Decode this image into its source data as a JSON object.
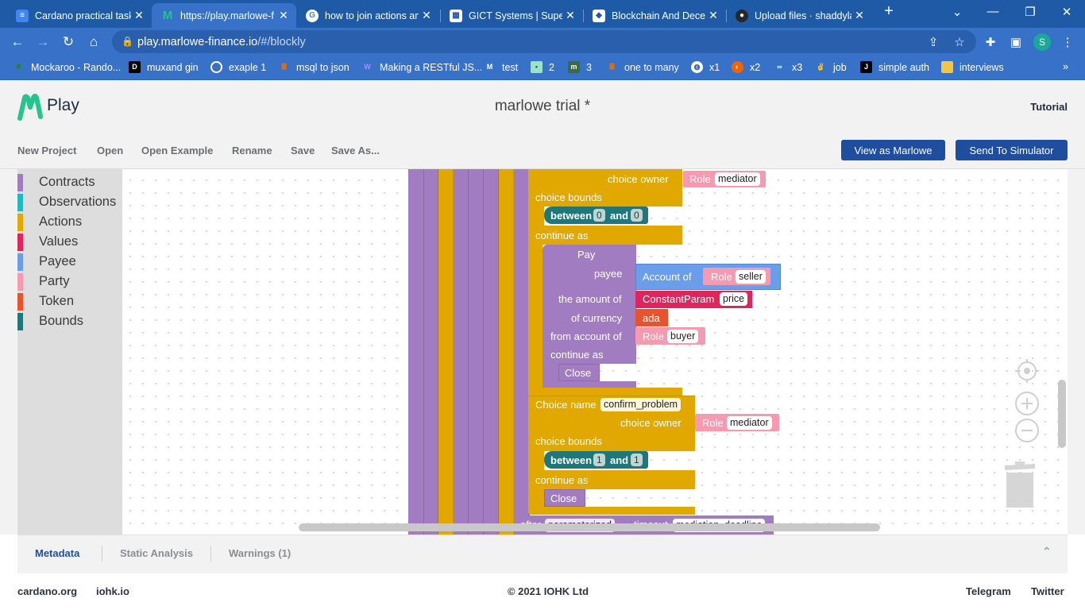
{
  "browser": {
    "tabs": [
      {
        "title": "Cardano practical task",
        "icon": "docs-icon",
        "color": "#4285f4"
      },
      {
        "title": "https://play.marlowe-f",
        "icon": "marlowe-icon",
        "color": "#23c48e"
      },
      {
        "title": "how to join actions an",
        "icon": "google-icon",
        "color": "#ffffff"
      },
      {
        "title": "GICT Systems | Super",
        "icon": "gict-icon",
        "color": "#ffffff"
      },
      {
        "title": "Blockchain And Decen",
        "icon": "blockchain-icon",
        "color": "#ffffff"
      },
      {
        "title": "Upload files · shaddyla",
        "icon": "github-icon",
        "color": "#24292e"
      }
    ],
    "url_host": "play.marlowe-finance.io",
    "url_path": "/#/blockly",
    "profile_initial": "S",
    "bookmarks": [
      {
        "label": "Mockaroo - Rando...",
        "icon": "mockaroo-icon",
        "color": "#2e7d32"
      },
      {
        "label": "muxand gin",
        "icon": "dev-icon",
        "color": "#000000"
      },
      {
        "label": "exaple 1",
        "icon": "target-icon",
        "color": "#ffffff"
      },
      {
        "label": "msql to json",
        "icon": "stackoverflow-icon",
        "color": "#e07a1f"
      },
      {
        "label": "Making a RESTful JS...",
        "icon": "w-icon",
        "color": "#7b3fe4"
      },
      {
        "label": "test",
        "icon": "gmail-icon",
        "color": "#1565c0"
      },
      {
        "label": "2",
        "icon": "square-icon",
        "color": "#9be2c8"
      },
      {
        "label": "3",
        "icon": "mh-icon",
        "color": "#3d6b3d"
      },
      {
        "label": "one to many",
        "icon": "stackoverflow-icon",
        "color": "#e07a1f"
      },
      {
        "label": "x1",
        "icon": "globe-icon",
        "color": "#ffffff"
      },
      {
        "label": "x2",
        "icon": "replit-icon",
        "color": "#f26207"
      },
      {
        "label": "x3",
        "icon": "infinity-icon",
        "color": "#ffffff"
      },
      {
        "label": "job",
        "icon": "hand-icon",
        "color": "#f4c542"
      },
      {
        "label": "simple auth",
        "icon": "j-icon",
        "color": "#000000"
      },
      {
        "label": "interviews",
        "icon": "folder-icon",
        "color": "#f6c545"
      }
    ]
  },
  "app": {
    "logo_text": "Play",
    "project_title": "marlowe trial *",
    "tutorial": "Tutorial",
    "menu": [
      "New Project",
      "Open",
      "Open Example",
      "Rename",
      "Save",
      "Save As..."
    ],
    "view_as_marlowe": "View as Marlowe",
    "send_to_simulator": "Send To Simulator"
  },
  "toolbox": [
    {
      "label": "Contracts",
      "color": "#a27cc0"
    },
    {
      "label": "Observations",
      "color": "#22b8c2"
    },
    {
      "label": "Actions",
      "color": "#e0a800"
    },
    {
      "label": "Values",
      "color": "#e0245e"
    },
    {
      "label": "Payee",
      "color": "#6a9eea"
    },
    {
      "label": "Party",
      "color": "#f59ab0"
    },
    {
      "label": "Token",
      "color": "#e8532c"
    },
    {
      "label": "Bounds",
      "color": "#1f777c"
    }
  ],
  "blocks": {
    "choice_owner_1": "choice owner",
    "role_1": "Role",
    "role_1_value": "mediator",
    "choice_bounds_1": "choice bounds",
    "between_1": "between",
    "between_1_low": "0",
    "and_1": "and",
    "between_1_high": "0",
    "continue_as_1": "continue as",
    "pay": "Pay",
    "payee": "payee",
    "account_of": "Account of",
    "role_seller": "Role",
    "role_seller_value": "seller",
    "amount_of": "the amount of",
    "constant_param": "ConstantParam",
    "constant_param_value": "price",
    "of_currency": "of currency",
    "ada": "ada",
    "from_account_of": "from account of",
    "role_buyer": "Role",
    "role_buyer_value": "buyer",
    "pay_continue_as": "continue as",
    "close_1": "Close",
    "choice_name": "Choice name",
    "choice_name_value": "confirm_problem",
    "choice_owner_2": "choice owner",
    "role_2": "Role",
    "role_2_value": "mediator",
    "choice_bounds_2": "choice bounds",
    "between_2": "between",
    "between_2_low": "1",
    "and_2": "and",
    "between_2_high": "1",
    "continue_as_2": "continue as",
    "close_2": "Close",
    "after": "after",
    "after_param": "parameterized",
    "timeout": "timeout",
    "timeout_value": "mediation_deadline"
  },
  "bottom_tabs": [
    "Metadata",
    "Static Analysis",
    "Warnings (1)"
  ],
  "footer": {
    "left": [
      "cardano.org",
      "iohk.io"
    ],
    "center": "© 2021 IOHK Ltd",
    "right": [
      "Telegram",
      "Twitter"
    ]
  },
  "colors": {
    "contract": "#a27cc0",
    "action": "#e0a800",
    "bounds": "#1f777c",
    "payee": "#6a9eea",
    "party": "#f59ab0",
    "value": "#e0245e",
    "token": "#e8532c",
    "primary_button": "#1f4e9e"
  }
}
